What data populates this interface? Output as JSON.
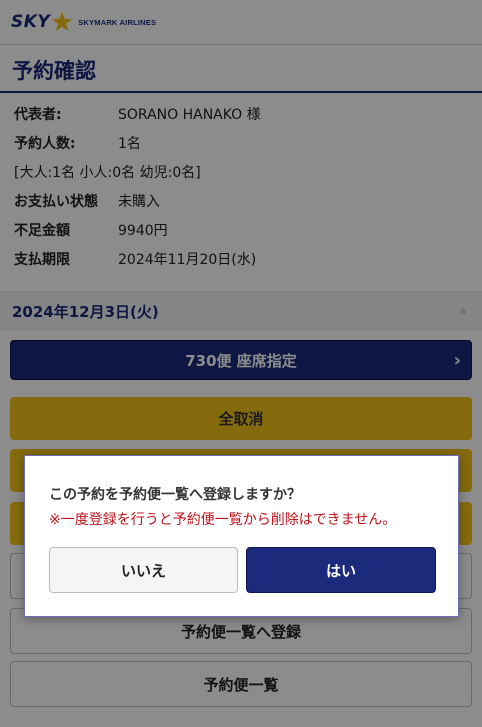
{
  "header": {
    "logo_sky": "SKY",
    "logo_sub": "SKYMARK AIRLINES",
    "title": "予約確認"
  },
  "reservation": {
    "rep_label": "代表者:",
    "rep_value": "SORANO HANAKO 様",
    "count_label": "予約人数:",
    "count_value": "1名",
    "breakdown": "[大人:1名 小人:0名 幼児:0名]",
    "pay_status_label": "お支払い状態",
    "pay_status_value": "未購入",
    "shortfall_label": "不足金額",
    "shortfall_value": "9940円",
    "deadline_label": "支払期限",
    "deadline_value": "2024年11月20日(水)"
  },
  "flight": {
    "date": "2024年12月3日(火)",
    "seat_button": "730便 座席指定"
  },
  "actions": {
    "cancel_all": "全取消",
    "register": "予約便一覧へ登録",
    "list": "予約便一覧"
  },
  "dialog": {
    "question": "この予約を予約便一覧へ登録しますか？",
    "warning": "※一度登録を行うと予約便一覧から削除はできません。",
    "no_label": "いいえ",
    "yes_label": "はい"
  },
  "colors": {
    "navy": "#1b2a7a",
    "yellow": "#f3c31a",
    "warning_red": "#c0131b"
  }
}
